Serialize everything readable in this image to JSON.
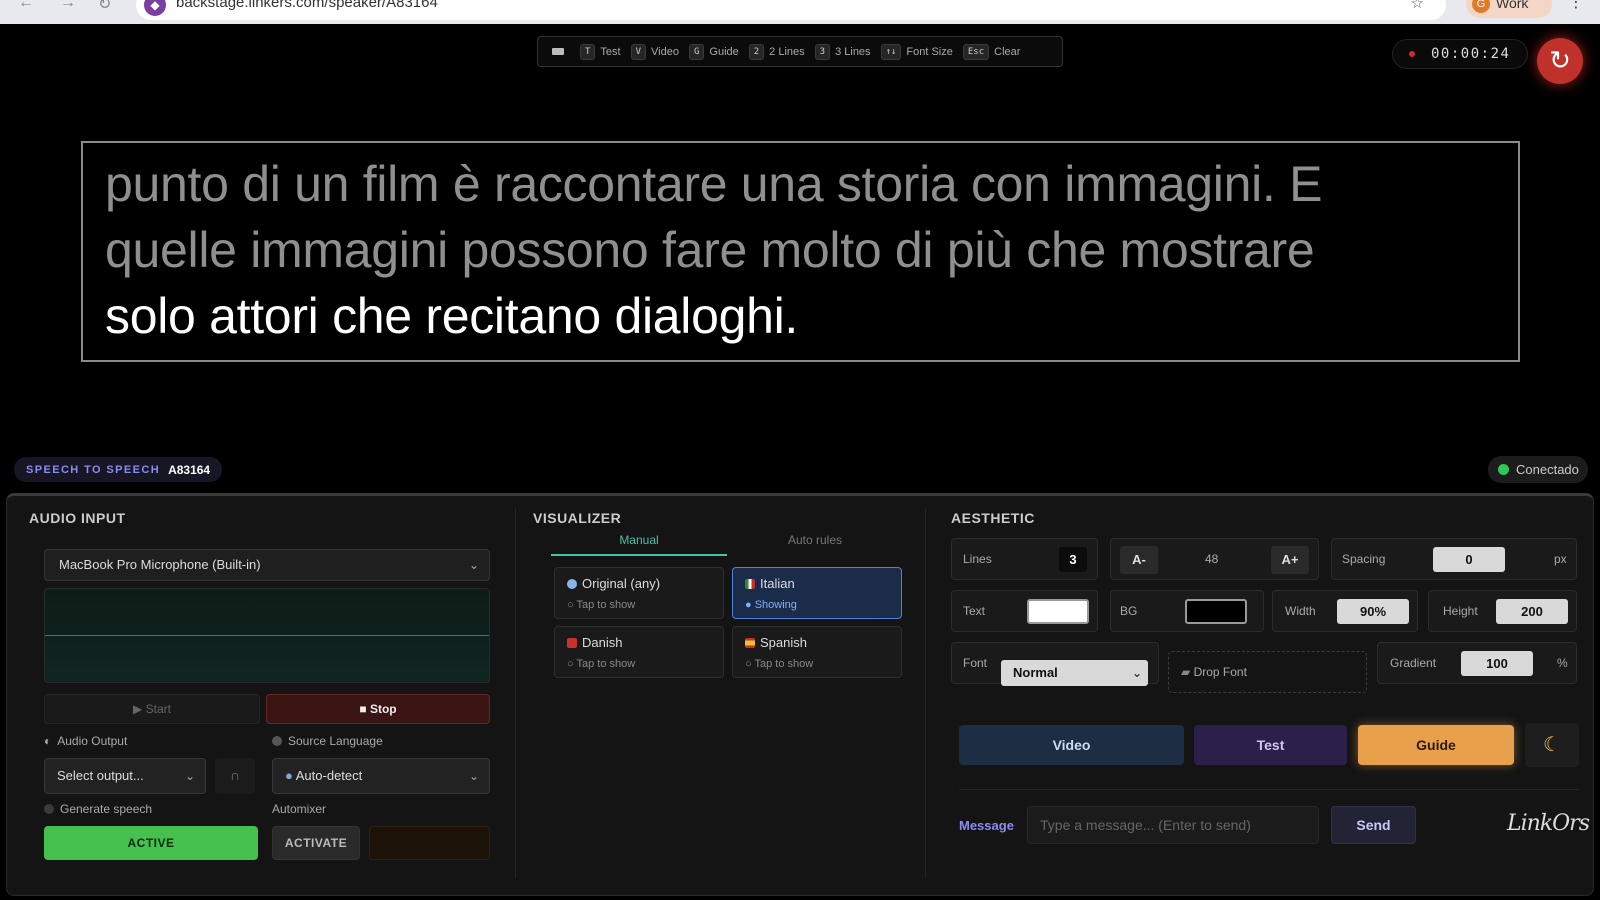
{
  "browser": {
    "url": "backstage.linkers.com/speaker/A83164",
    "profile_label": "Work",
    "profile_initial": "G"
  },
  "shortcuts": [
    {
      "key": "T",
      "label": "Test"
    },
    {
      "key": "V",
      "label": "Video"
    },
    {
      "key": "G",
      "label": "Guide"
    },
    {
      "key": "2",
      "label": "2 Lines"
    },
    {
      "key": "3",
      "label": "3 Lines"
    },
    {
      "key": "↑↓",
      "label": "Font Size"
    },
    {
      "key": "Esc",
      "label": "Clear"
    }
  ],
  "timer": "00:00:24",
  "reset_icon": "↻",
  "caption": {
    "lines": [
      "punto di un film è raccontare una storia con immagini. E",
      "quelle immagini possono fare molto di più che mostrare",
      "solo attori che recitano dialoghi."
    ]
  },
  "session": {
    "mode_label": "SPEECH TO SPEECH",
    "id": "A83164",
    "connection_status": "Conectado",
    "connection_color": "#2fc65a"
  },
  "audio_input": {
    "title": "AUDIO INPUT",
    "device": "MacBook Pro Microphone (Built-in)",
    "start_label": "▶ Start",
    "stop_label": "■ Stop",
    "output_label": "Audio Output",
    "output_value": "Select output...",
    "source_language_label": "Source Language",
    "source_language_value": "Auto-detect",
    "generate_speech_label": "Generate speech",
    "active_label": "ACTIVE",
    "automixer_label": "Automixer",
    "activate_label": "ACTIVATE"
  },
  "visualizer": {
    "title": "VISUALIZER",
    "tabs": [
      "Manual",
      "Auto rules"
    ],
    "languages": [
      {
        "name": "Original (any)",
        "status": "Tap to show"
      },
      {
        "name": "Italian",
        "status": "Showing"
      },
      {
        "name": "Danish",
        "status": "Tap to show"
      },
      {
        "name": "Spanish",
        "status": "Tap to show"
      }
    ]
  },
  "aesthetic": {
    "title": "AESTHETIC",
    "lines_label": "Lines",
    "lines_value": "3",
    "font_minus": "A-",
    "font_size": "48",
    "font_plus": "A+",
    "spacing_label": "Spacing",
    "spacing_value": "0",
    "spacing_unit": "px",
    "text_label": "Text",
    "text_color": "#ffffff",
    "bg_label": "BG",
    "bg_color": "#000000",
    "width_label": "Width",
    "width_value": "90%",
    "height_label": "Height",
    "height_value": "200",
    "font_label": "Font",
    "font_value": "Normal",
    "drop_font_label": "Drop Font",
    "gradient_label": "Gradient",
    "gradient_value": "100",
    "gradient_unit": "%",
    "video_label": "Video",
    "test_label": "Test",
    "guide_label": "Guide",
    "moon_icon": "☾",
    "message_label": "Message",
    "message_placeholder": "Type a message... (Enter to send)",
    "send_label": "Send",
    "logo_text": "LinkOrs"
  }
}
